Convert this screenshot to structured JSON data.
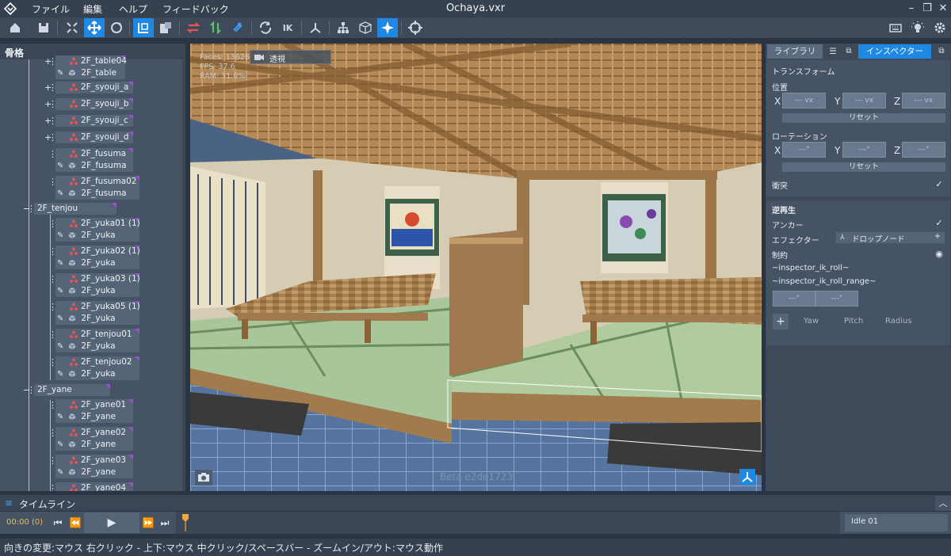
{
  "app": {
    "title": "Ochaya.vxr",
    "menu": [
      "ファイル",
      "編集",
      "ヘルプ",
      "フィードバック"
    ]
  },
  "colors": {
    "accent": "#1e88e5",
    "panel": "#465364",
    "dark": "#2b3442",
    "purple_marker": "#a04cd8"
  },
  "toolbar": {
    "icons": [
      "home-icon",
      "save-icon",
      "fit-view-icon",
      "move-icon",
      "rotate-icon",
      "local-space-icon",
      "library-icon",
      "swap-red-icon",
      "swap-green-icon",
      "swap-blue-icon",
      "refresh-icon",
      "ik-icon",
      "axis-icon",
      "hierarchy-icon",
      "cube-icon",
      "sparkle-icon",
      "target-icon",
      "keyboard-icon",
      "bulb-icon",
      "gear-icon"
    ],
    "ik_label": "IK",
    "active": [
      "move-icon",
      "local-space-icon",
      "sparkle-icon"
    ]
  },
  "skeleton": {
    "title": "骨格",
    "nodes": [
      {
        "name": "2F_table04",
        "sub": "2F_table",
        "expand": "+"
      },
      {
        "name": "2F_syouji_a",
        "expand": "+"
      },
      {
        "name": "2F_syouji_b",
        "expand": "+"
      },
      {
        "name": "2F_syouji_c",
        "expand": "+"
      },
      {
        "name": "2F_syouji_d",
        "expand": "+"
      },
      {
        "name": "2F_fusuma",
        "sub": "2F_fusuma"
      },
      {
        "name": "2F_fusuma02",
        "sub": "2F_fusuma"
      },
      {
        "name": "2F_tenjou",
        "expand": "−"
      },
      {
        "name": "2F_yuka01 (1)",
        "sub": "2F_yuka"
      },
      {
        "name": "2F_yuka02 (1)",
        "sub": "2F_yuka"
      },
      {
        "name": "2F_yuka03 (1)",
        "sub": "2F_yuka"
      },
      {
        "name": "2F_yuka05 (1)",
        "sub": "2F_yuka"
      },
      {
        "name": "2F_tenjou01",
        "sub": "2F_yuka"
      },
      {
        "name": "2F_tenjou02",
        "sub": "2F_yuka"
      },
      {
        "name": "2F_yane",
        "expand": "−"
      },
      {
        "name": "2F_yane01",
        "sub": "2F_yane"
      },
      {
        "name": "2F_yane02",
        "sub": "2F_yane"
      },
      {
        "name": "2F_yane03",
        "sub": "2F_yane"
      },
      {
        "name": "2F_yane04",
        "sub": ""
      }
    ]
  },
  "viewport": {
    "stats": [
      "Faces: 13626",
      "FPS: 37.6",
      "RAM: 31.0%"
    ],
    "mode": "透視",
    "build": "Beta e2de1723"
  },
  "inspector": {
    "tabs": {
      "library": "ライブラリ",
      "inspector": "インスペクター"
    },
    "transform": {
      "title": "トランスフォーム",
      "position_label": "位置",
      "position_fields": [
        "--- vx",
        "--- vx",
        "--- vx"
      ],
      "rotation_label": "ローテーション",
      "rotation_fields": [
        "---°",
        "---°",
        "---°"
      ],
      "axes": [
        "X",
        "Y",
        "Z"
      ],
      "reset": "リセット",
      "collision": "衝突",
      "collision_checked": true
    },
    "reverse": {
      "title": "逆再生",
      "anchor": "アンカー",
      "anchor_checked": true,
      "effector": "エフェクター",
      "drop_node": "ドロップノード",
      "constraint": "制約",
      "ik_roll": "~inspector_ik_roll~",
      "ik_roll_range": "~inspector_ik_roll_range~",
      "range_fields": [
        "---°",
        "---°"
      ],
      "cols": [
        "Yaw",
        "Pitch",
        "Radius"
      ]
    }
  },
  "timeline": {
    "title": "タイムライン",
    "time": "00:00 (0)",
    "clip": "Idle 01"
  },
  "status": "向きの変更:マウス 右クリック - 上下:マウス 中クリック/スペースバー - ズームイン/アウト:マウス動作"
}
